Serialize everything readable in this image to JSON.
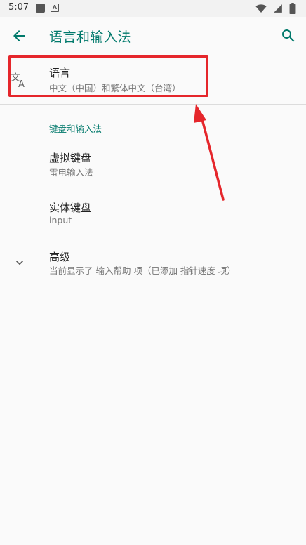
{
  "status_bar": {
    "time": "5:07",
    "notif_a_letter": "A"
  },
  "app_bar": {
    "title": "语言和输入法",
    "back_icon": "arrow-left-icon",
    "search_icon": "search-icon"
  },
  "language": {
    "title": "语言",
    "summary": "中文（中国）和繁体中文（台湾）",
    "icon": "translate-icon"
  },
  "keyboard_section": {
    "header": "键盘和输入法",
    "virtual_keyboard": {
      "title": "虚拟键盘",
      "summary": "雷电输入法"
    },
    "physical_keyboard": {
      "title": "实体键盘",
      "summary": "input"
    }
  },
  "advanced": {
    "title": "高级",
    "summary": "当前显示了 输入帮助 项（已添加 指针速度 项）",
    "icon": "chevron-down-icon"
  },
  "colors": {
    "accent": "#00796b",
    "highlight": "#e5262b",
    "annotation_arrow": "#e5262b"
  }
}
